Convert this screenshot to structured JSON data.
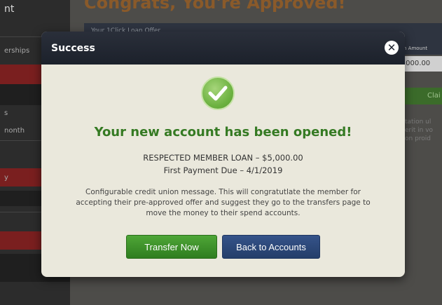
{
  "background": {
    "sidebar_top": "nt",
    "sidebar_items": [
      "erships",
      "s",
      "nonth",
      "y"
    ],
    "headline": "Congrats, You're Approved!",
    "offer_title": "Your 1Click Loan Offer",
    "amount_header": "n Amount",
    "amount_value": ",000.00",
    "claim_button": "Clai",
    "side_text": [
      "tation ul",
      "erit in vo",
      "on proid"
    ]
  },
  "modal": {
    "title": "Success",
    "close_icon": "close-icon",
    "check_icon": "checkmark-circle-icon",
    "heading": "Your new account has been opened!",
    "loan_line": "RESPECTED MEMBER LOAN – $5,000.00",
    "due_line": "First Payment Due – 4/1/2019",
    "message": "Configurable credit union message. This will congratutlate the member for accepting their pre-approved offer and suggest they go to the transfers page to move the money to their spend accounts.",
    "transfer_button": "Transfer Now",
    "back_button": "Back to Accounts"
  },
  "colors": {
    "accent_green": "#357a23",
    "button_green": "#3f9129",
    "button_blue": "#2d4a7c",
    "header_dark": "#1f2430"
  }
}
